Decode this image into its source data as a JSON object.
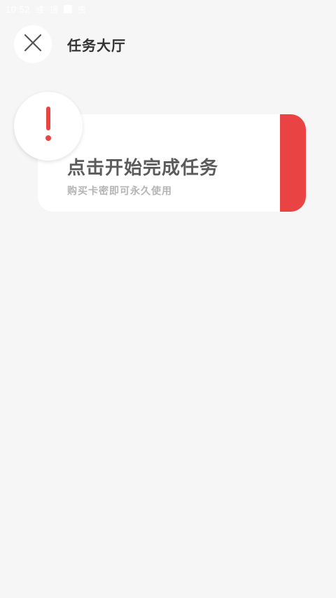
{
  "status_bar": {
    "time": "10:52",
    "icons": [
      "notification-icon",
      "signal-icon",
      "app-icon",
      "bug-icon"
    ],
    "glyphs": [
      "彧",
      "搜",
      "",
      "虫"
    ]
  },
  "header": {
    "title": "任务大厅",
    "close_icon": "close-icon"
  },
  "task_card": {
    "title": "点击开始完成任务",
    "subtitle": "购买卡密即可永久使用",
    "alert_icon": "exclamation-icon",
    "accent_color": "#ea4343"
  },
  "colors": {
    "background": "#f6f6f6",
    "card": "#ffffff",
    "accent": "#ea4343",
    "title_text": "#5b5b5b",
    "subtitle_text": "#b4b4b4"
  }
}
